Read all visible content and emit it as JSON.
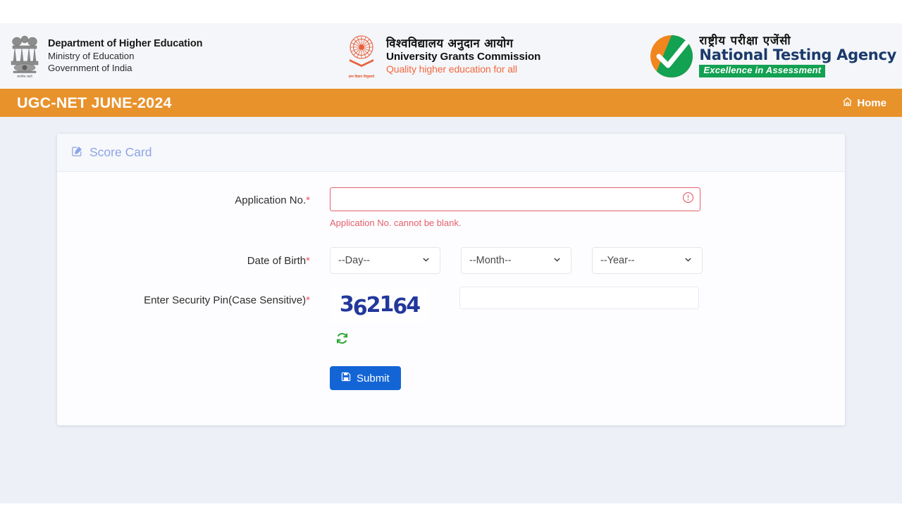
{
  "header": {
    "dhe": {
      "line1": "Department of Higher Education",
      "line2": "Ministry of Education",
      "line3": "Government of India",
      "emblem_caption": "सत्यमेव जयते"
    },
    "ugc": {
      "hindi": "विश्वविद्यालय अनुदान आयोग",
      "english": "University Grants Commission",
      "tagline": "Quality higher education for all",
      "emblem_caption": "ज्ञान-विज्ञान विमुक्तये"
    },
    "nta": {
      "hindi": "राष्ट्रीय परीक्षा एजेंसी",
      "english": "National Testing Agency",
      "tagline": "Excellence in Assessment"
    }
  },
  "navbar": {
    "title": "UGC-NET JUNE-2024",
    "home_label": "Home"
  },
  "card": {
    "title": "Score Card"
  },
  "form": {
    "application_no": {
      "label": "Application No.",
      "required_mark": "*",
      "value": "",
      "placeholder": "",
      "error": "Application No. cannot be blank."
    },
    "date_of_birth": {
      "label": "Date of Birth",
      "required_mark": "*",
      "day": "--Day--",
      "month": "--Month--",
      "year": "--Year--"
    },
    "security_pin": {
      "label": "Enter Security Pin(Case Sensitive)",
      "required_mark": "*",
      "captcha_value": "362164",
      "value": "",
      "placeholder": ""
    },
    "submit_label": "Submit"
  },
  "colors": {
    "orange_bar": "#e8922c",
    "page_bg": "#eef0f7",
    "card_title": "#8ea4e8",
    "error": "#e4606d",
    "submit": "#1365d6",
    "captcha": "#22389c",
    "nta_green": "#13a152",
    "nta_orange": "#f1861f"
  }
}
